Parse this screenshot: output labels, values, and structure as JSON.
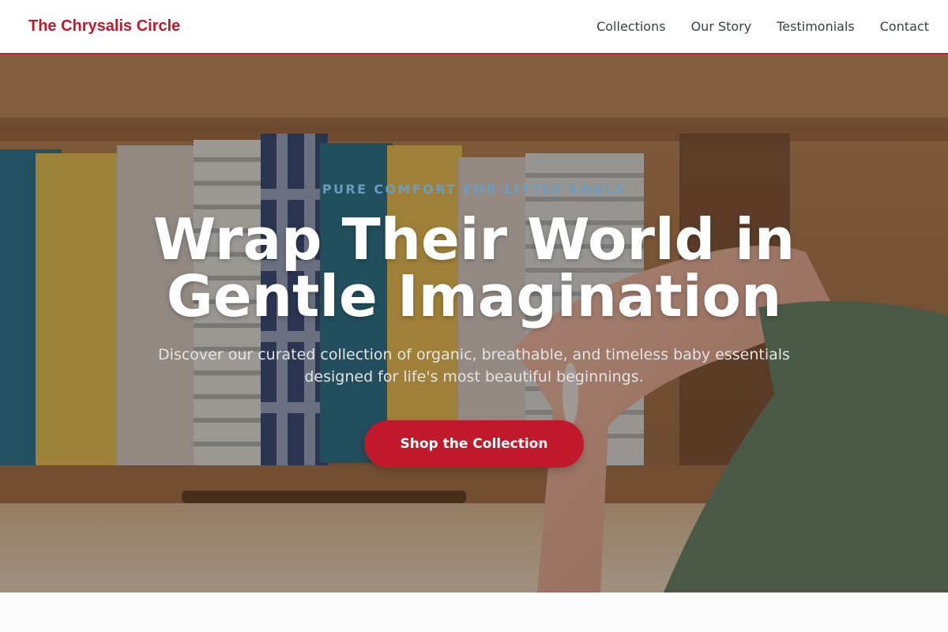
{
  "header": {
    "brand": "The Chrysalis Circle",
    "nav": [
      "Collections",
      "Our Story",
      "Testimonials",
      "Contact"
    ]
  },
  "hero": {
    "eyebrow": "PURE COMFORT FOR LITTLE SOULS",
    "title_line1": "Wrap Their World in",
    "title_line2": "Gentle Imagination",
    "subtitle": "Discover our curated collection of organic, breathable, and timeless baby essentials designed for life's most beautiful beginnings.",
    "cta_label": "Shop the Collection"
  },
  "colors": {
    "brand": "#be1a2b",
    "cta": "#c0192b",
    "eyebrow": "#6d9cc1"
  }
}
